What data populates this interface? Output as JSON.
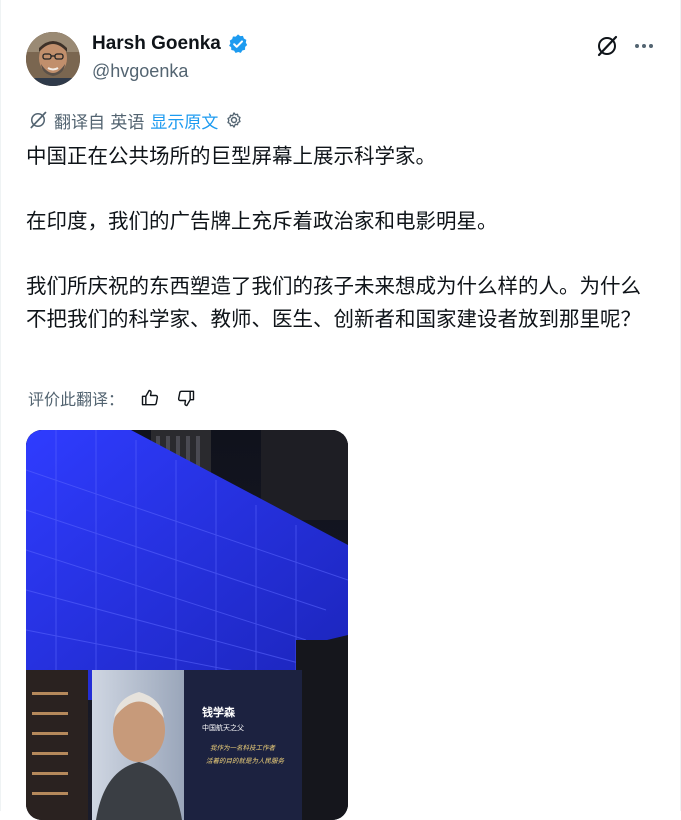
{
  "tweet": {
    "author_name": "Harsh Goenka",
    "author_handle": "@hvgoenka",
    "verified": true
  },
  "translation": {
    "translated_from": "翻译自 英语",
    "show_original": "显示原文"
  },
  "body": {
    "paragraph_1": "中国正在公共场所的巨型屏幕上展示科学家。",
    "paragraph_2": "在印度，我们的广告牌上充斥着政治家和电影明星。",
    "paragraph_3": "我们所庆祝的东西塑造了我们的孩子未来想成为什么样的人。为什么不把我们的科学家、教师、医生、创新者和国家建设者放到那里呢？"
  },
  "rate": {
    "label": "评价此翻译："
  },
  "media": {
    "screen_name": "钱学森",
    "screen_title": "中国航天之父",
    "screen_quote_1": "我作为一名科技工作者",
    "screen_quote_2": "活着的目的就是为人民服务"
  },
  "colors": {
    "link": "#1d9bf0",
    "secondary_text": "#536471",
    "primary_text": "#0f1419",
    "verified": "#1d9bf0"
  },
  "icons": {
    "verified": "verified-badge-icon",
    "grok": "grok-icon",
    "more": "more-icon",
    "translate": "translate-icon",
    "settings": "gear-icon",
    "thumbs_up": "thumbs-up-icon",
    "thumbs_down": "thumbs-down-icon"
  }
}
